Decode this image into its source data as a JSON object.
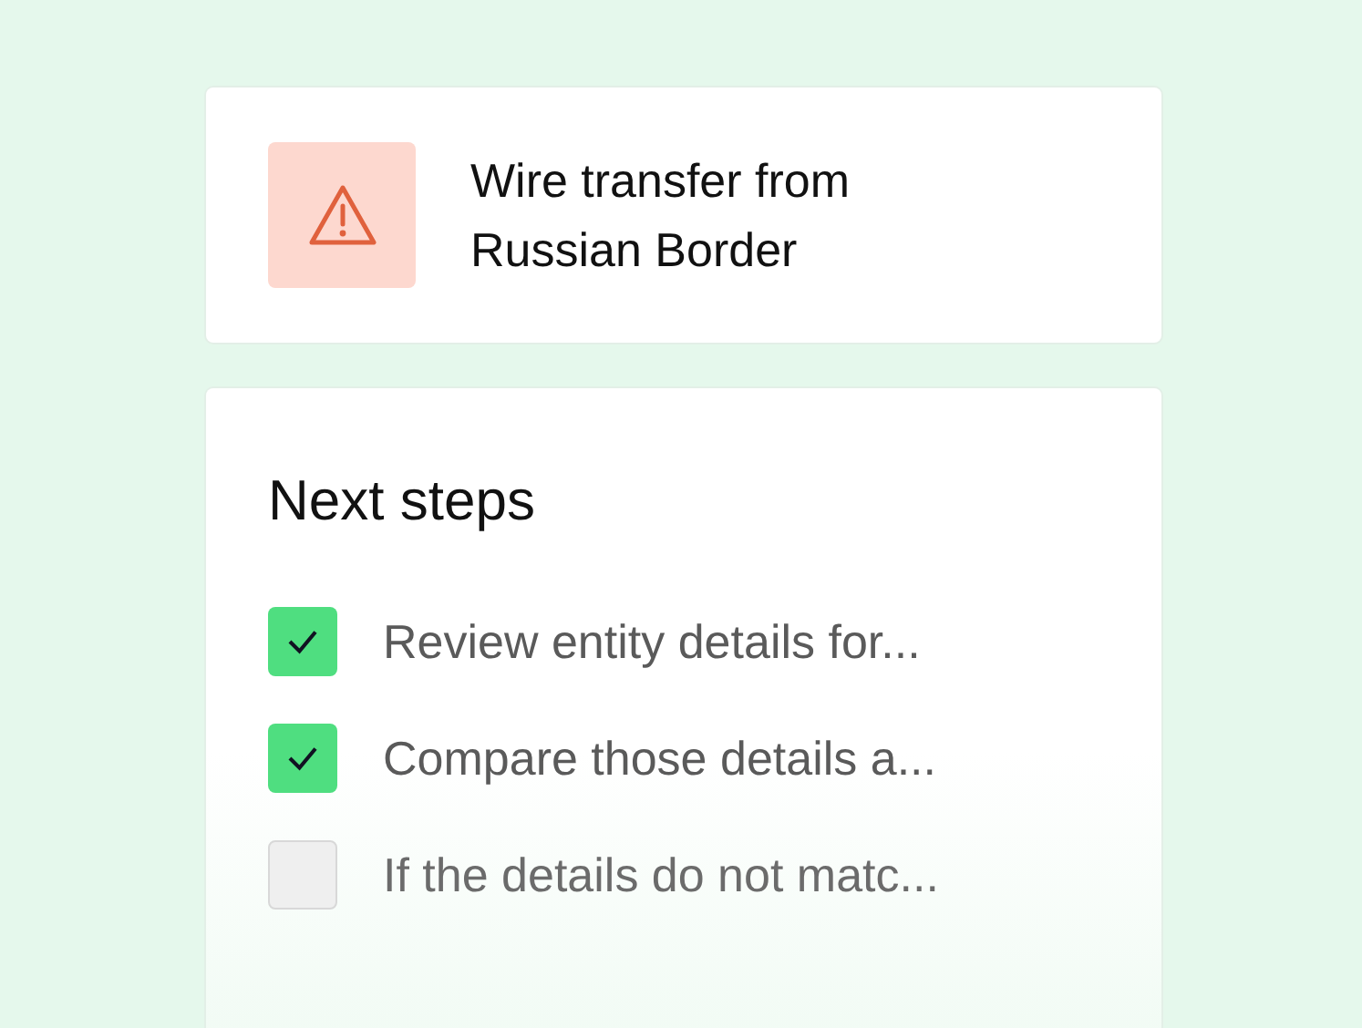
{
  "alert": {
    "title": "Wire transfer from\nRussian Border"
  },
  "next_steps": {
    "title": "Next steps",
    "items": [
      {
        "label": "Review entity details for...",
        "checked": true
      },
      {
        "label": "Compare those details a...",
        "checked": true
      },
      {
        "label": "If the details do not matc...",
        "checked": false
      }
    ]
  }
}
